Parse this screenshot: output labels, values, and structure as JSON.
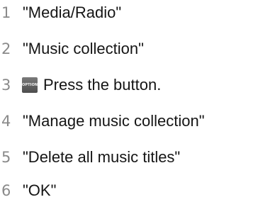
{
  "steps": [
    {
      "number": "1",
      "text": "\"Media/Radio\""
    },
    {
      "number": "2",
      "text": "\"Music collection\""
    },
    {
      "number": "3",
      "icon": {
        "name": "option-button-icon",
        "label": "OPTION"
      },
      "text": "Press the button."
    },
    {
      "number": "4",
      "text": "\"Manage music collection\""
    },
    {
      "number": "5",
      "text": "\"Delete all music titles\""
    },
    {
      "number": "6",
      "text": "\"OK\""
    }
  ]
}
